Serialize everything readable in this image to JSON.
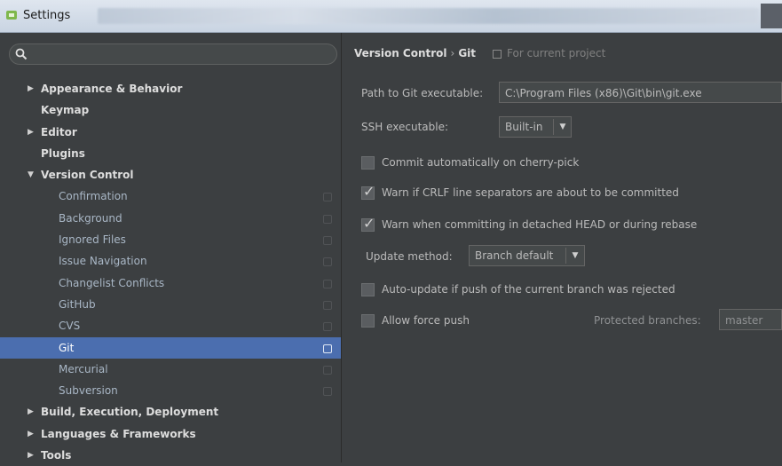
{
  "window": {
    "title": "Settings"
  },
  "search": {
    "placeholder": ""
  },
  "tree": [
    {
      "label": "Appearance & Behavior",
      "level": 0,
      "arrow": "▶"
    },
    {
      "label": "Keymap",
      "level": 0,
      "arrow": ""
    },
    {
      "label": "Editor",
      "level": 0,
      "arrow": "▶"
    },
    {
      "label": "Plugins",
      "level": 0,
      "arrow": ""
    },
    {
      "label": "Version Control",
      "level": 0,
      "arrow": "▼"
    },
    {
      "label": "Confirmation",
      "level": 1,
      "project": true
    },
    {
      "label": "Background",
      "level": 1,
      "project": true
    },
    {
      "label": "Ignored Files",
      "level": 1,
      "project": true
    },
    {
      "label": "Issue Navigation",
      "level": 1,
      "project": true
    },
    {
      "label": "Changelist Conflicts",
      "level": 1,
      "project": true
    },
    {
      "label": "GitHub",
      "level": 1,
      "project": true
    },
    {
      "label": "CVS",
      "level": 1,
      "project": true
    },
    {
      "label": "Git",
      "level": 1,
      "project": true,
      "selected": true
    },
    {
      "label": "Mercurial",
      "level": 1,
      "project": true
    },
    {
      "label": "Subversion",
      "level": 1,
      "project": true
    },
    {
      "label": "Build, Execution, Deployment",
      "level": 0,
      "arrow": "▶"
    },
    {
      "label": "Languages & Frameworks",
      "level": 0,
      "arrow": "▶"
    },
    {
      "label": "Tools",
      "level": 0,
      "arrow": "▶"
    }
  ],
  "breadcrumb": {
    "parent": "Version Control",
    "separator": "›",
    "current": "Git",
    "scope": "For current project"
  },
  "git": {
    "path_label": "Path to Git executable:",
    "path_value": "C:\\Program Files (x86)\\Git\\bin\\git.exe",
    "ssh_label": "SSH executable:",
    "ssh_value": "Built-in",
    "cherry_pick": {
      "label": "Commit automatically on cherry-pick",
      "checked": false
    },
    "crlf": {
      "label": "Warn if CRLF line separators are about to be committed",
      "checked": true
    },
    "detached": {
      "label": "Warn when committing in detached HEAD or during rebase",
      "checked": true
    },
    "update_label": "Update method:",
    "update_value": "Branch default",
    "auto_update": {
      "label": "Auto-update if push of the current branch was rejected",
      "checked": false
    },
    "force_push": {
      "label": "Allow force push",
      "checked": false
    },
    "protected_label": "Protected branches:",
    "protected_value": "master"
  },
  "colors": {
    "background": "#3c3f41",
    "selection": "#4b6eaf",
    "text": "#bbbbbb"
  }
}
